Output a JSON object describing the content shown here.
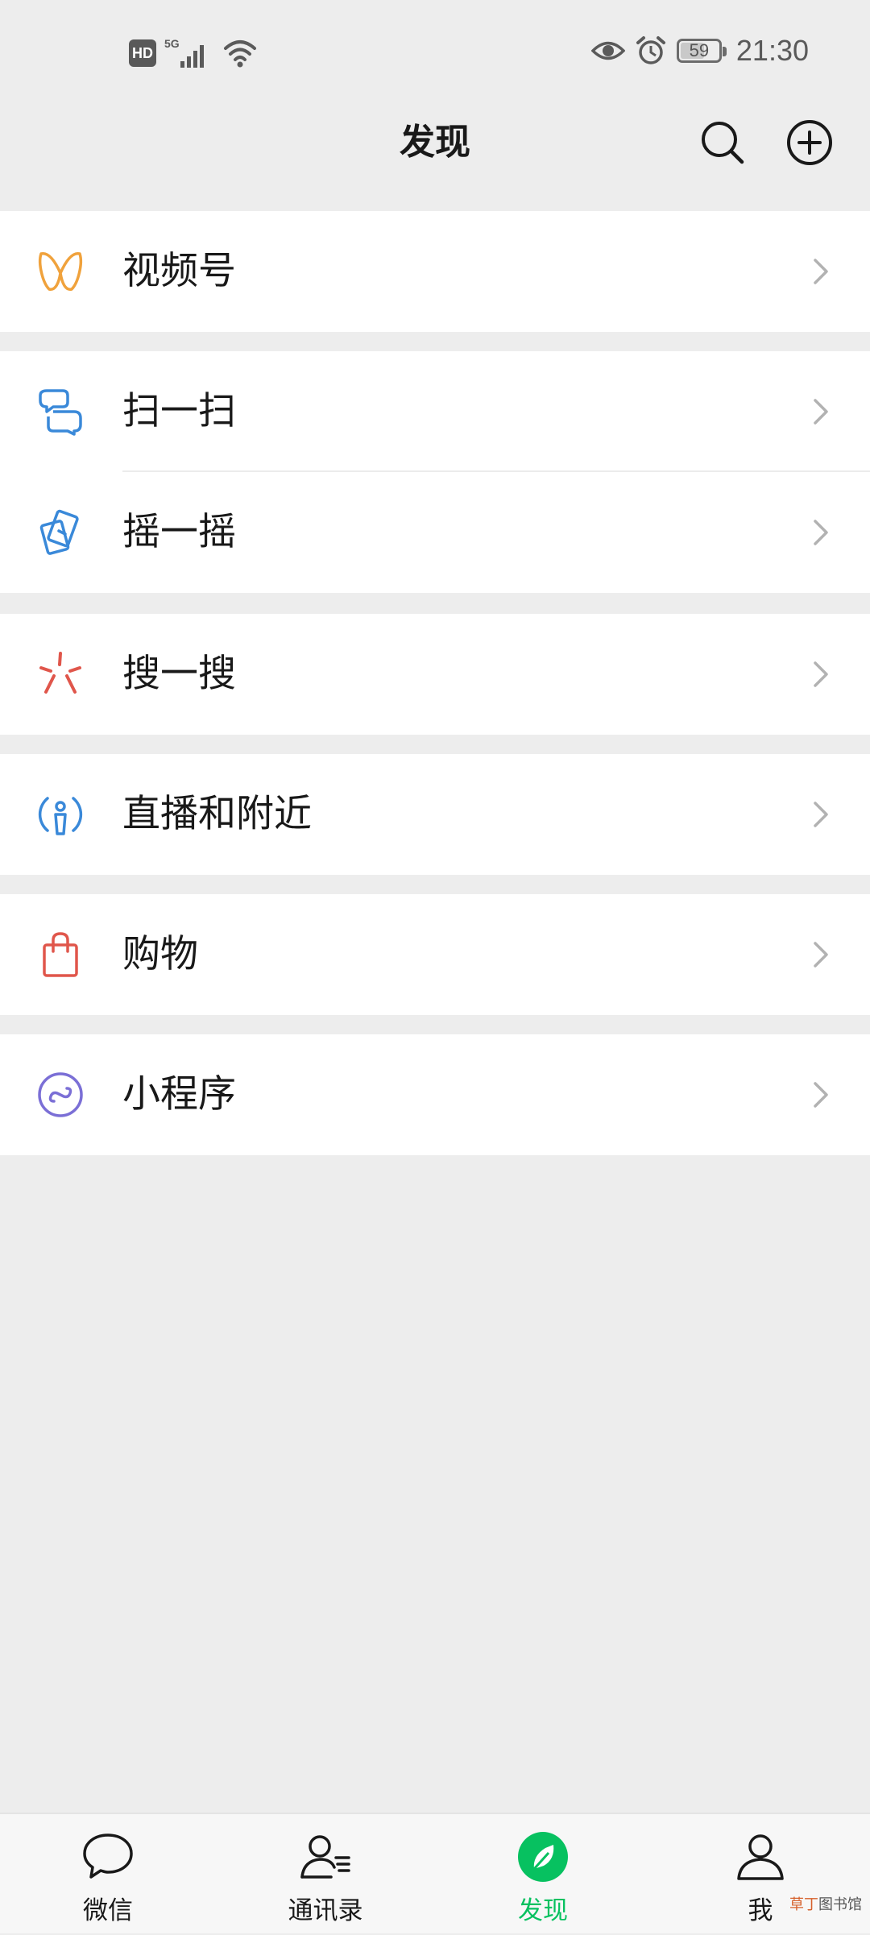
{
  "status_bar": {
    "hd": "HD",
    "network": "5G",
    "battery": "59",
    "time": "21:30"
  },
  "header": {
    "title": "发现",
    "search_icon": "search-icon",
    "add_icon": "plus-circle-icon"
  },
  "menu": {
    "channels": "视频号",
    "scan": "扫一扫",
    "shake": "摇一摇",
    "search": "搜一搜",
    "live_nearby": "直播和附近",
    "shopping": "购物",
    "mini_programs": "小程序"
  },
  "colors": {
    "channels": "#f0a23c",
    "scan": "#3a89d9",
    "shake": "#3a89d9",
    "search": "#e0564b",
    "live_nearby": "#3a89d9",
    "shopping": "#e0564b",
    "mini_programs": "#7b6fd6",
    "active_tab": "#07c160"
  },
  "tabbar": {
    "chats": "微信",
    "contacts": "通讯录",
    "discover": "发现",
    "me": "我"
  },
  "watermark": {
    "brand": "草丁",
    "suffix": "图书馆"
  }
}
